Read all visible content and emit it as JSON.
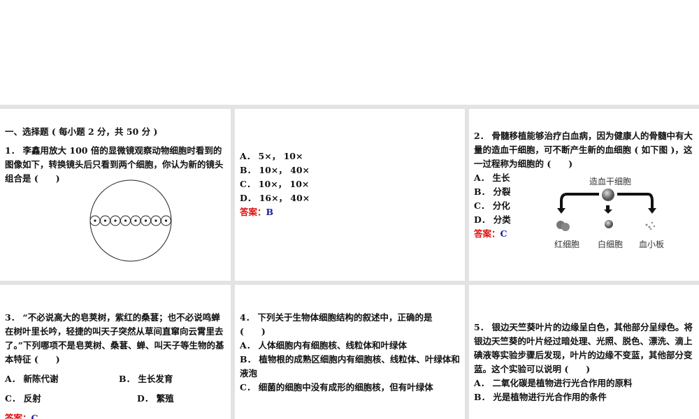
{
  "section_title": "一、选择题 ( 每小题 2 分，共 50 分 )",
  "answer_label": "答案：",
  "q1": {
    "text": "1． 李鑫用放大 100 倍的显微镜观察动物细胞时看到的图像如下，转换镜头后只看到两个细胞，你认为新的镜头组合是 (　　)",
    "options": [
      "A． 5×， 10×",
      "B． 10×， 40×",
      "C． 10×， 10×",
      "D． 16×， 40×"
    ],
    "answer": "B"
  },
  "q2": {
    "text": "2． 骨髓移植能够治疗白血病，因为健康人的骨髓中有大量的造血干细胞，可不断产生新的血细胞 ( 如下图 )，这一过程称为细胞的 (　　)",
    "options": [
      "A． 生长",
      "B． 分裂",
      "C． 分化",
      "D． 分类"
    ],
    "answer": "C",
    "diagram": {
      "source": "造血干细胞",
      "targets": [
        "红细胞",
        "白细胞",
        "血小板"
      ]
    }
  },
  "q3": {
    "text": "3． “不必说高大的皂荚树，紫红的桑葚；也不必说鸣蝉在树叶里长吟，轻捷的叫天子突然从草间直窜向云霄里去了。”下列哪项不是皂荚树、桑葚、蝉、叫天子等生物的基本特征 (　　)",
    "options": [
      "A． 新陈代谢",
      "B． 生长发育",
      "C． 反射",
      "D． 繁殖"
    ],
    "answer": "C"
  },
  "q4": {
    "text": "4． 下列关于生物体细胞结构的叙述中，正确的是 (　　)",
    "options": [
      "A． 人体细胞内有细胞核、线粒体和叶绿体",
      "B． 植物根的成熟区细胞内有细胞核、线粒体、叶绿体和液泡",
      "C． 细菌的细胞中没有成形的细胞核，但有叶绿体"
    ]
  },
  "q5": {
    "text": "5． 银边天竺葵叶片的边缘呈白色，其他部分呈绿色。将银边天竺葵的叶片经过暗处理、光照、脱色、漂洗、滴上碘液等实验步骤后发现，叶片的边缘不变蓝，其他部分变蓝。这个实验可以说明 (　　)",
    "options": [
      "A． 二氧化碳是植物进行光合作用的原料",
      "B． 光是植物进行光合作用的条件"
    ]
  }
}
